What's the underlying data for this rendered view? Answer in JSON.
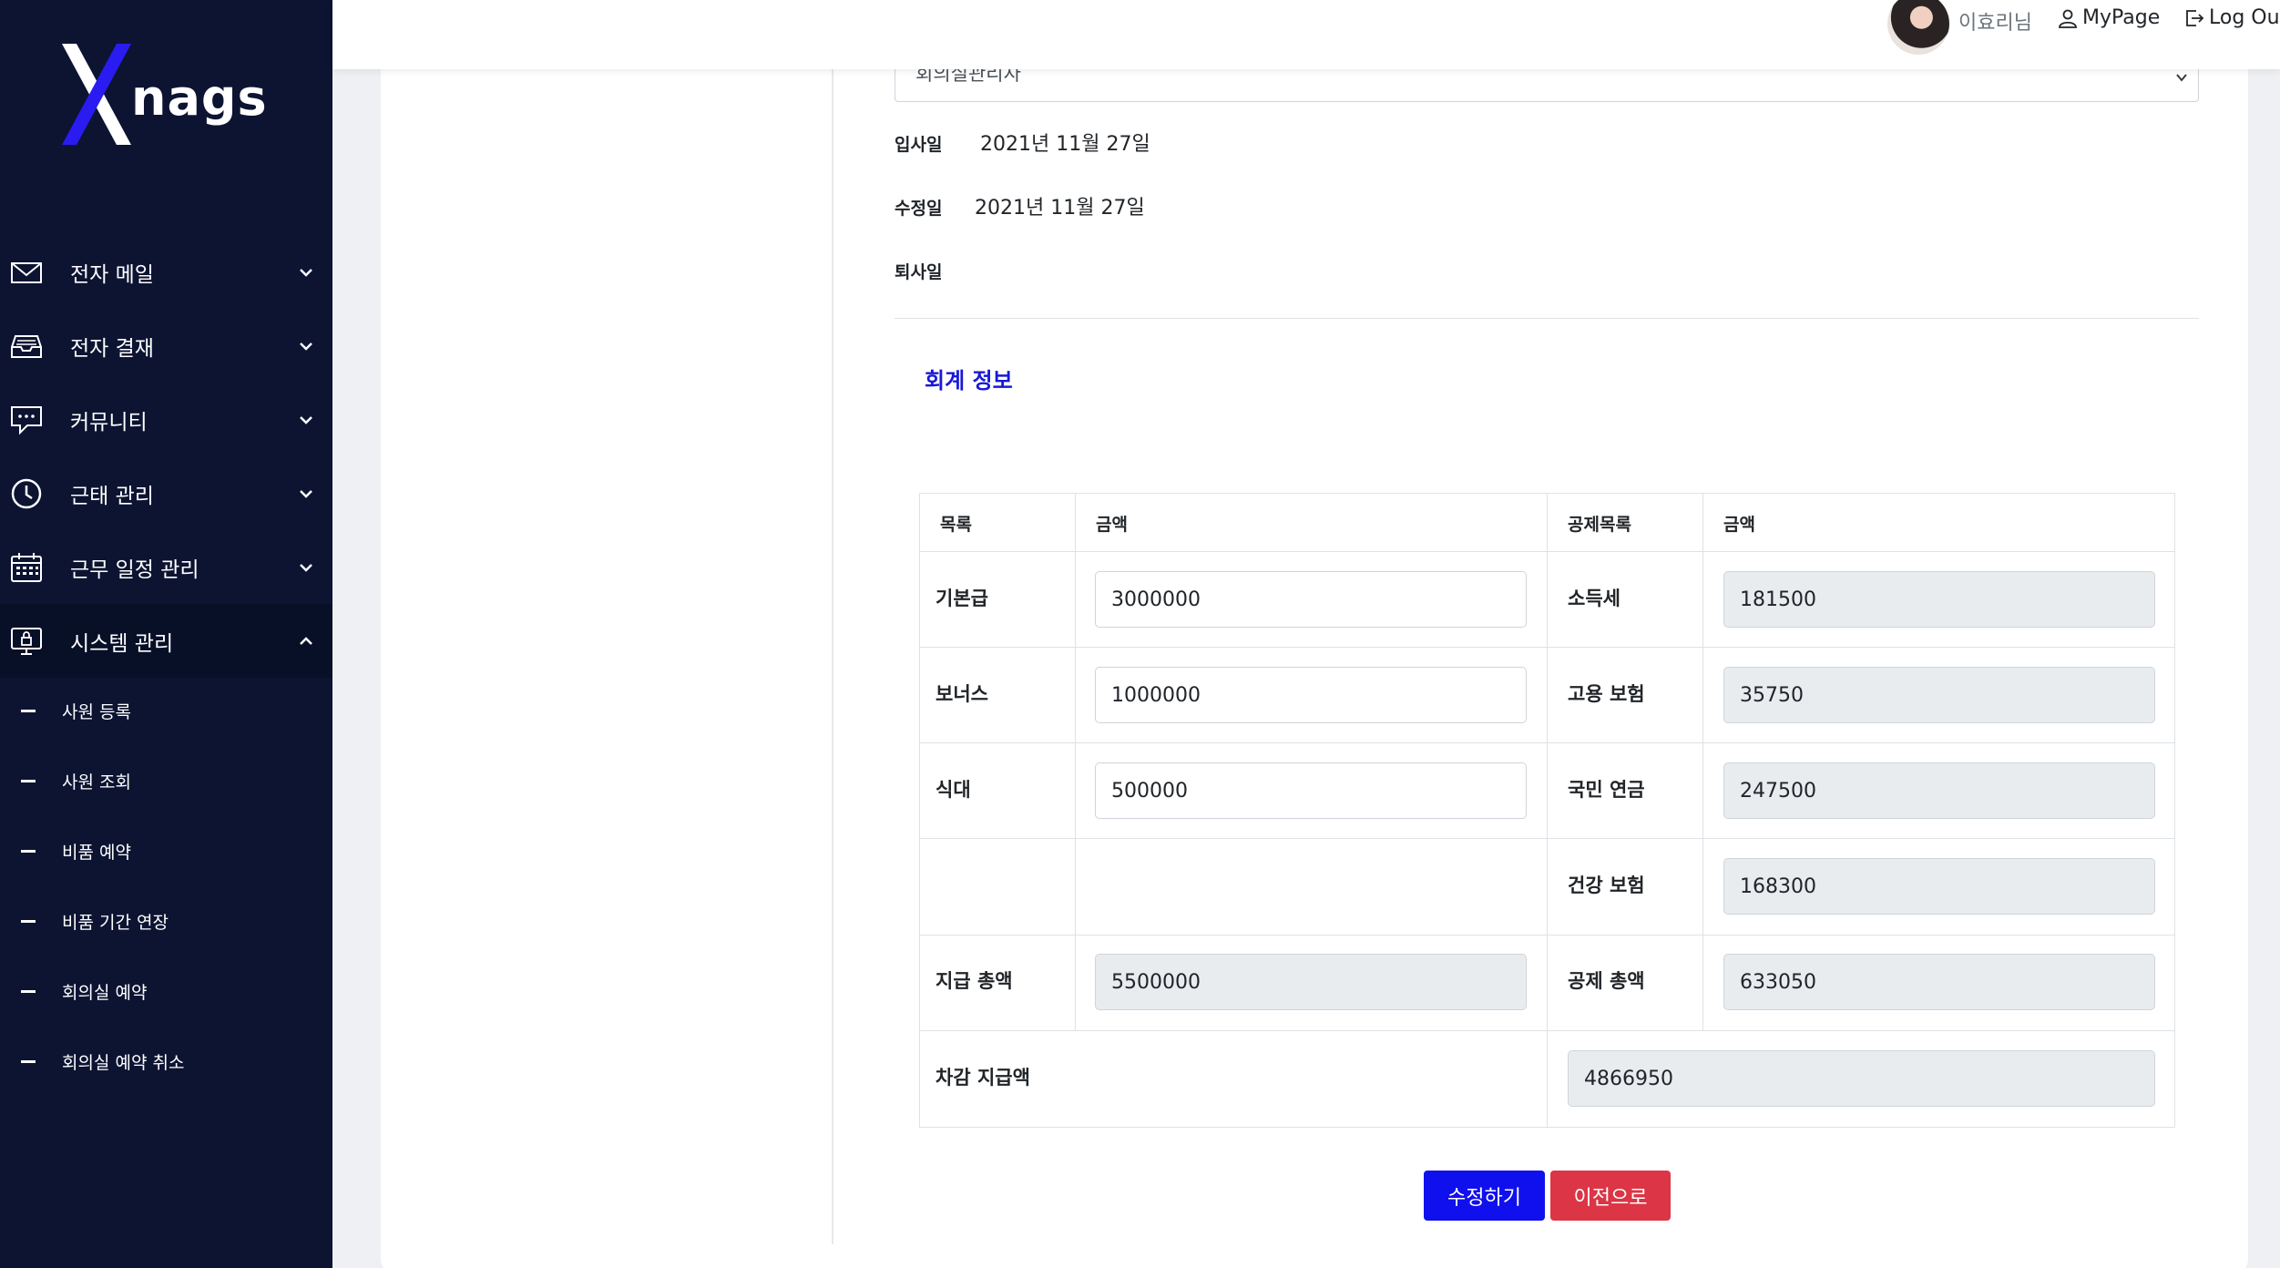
{
  "brand": {
    "logo_text": "nags",
    "logo_letter": "X"
  },
  "sidebar": {
    "items": [
      {
        "label": "전자 메일",
        "icon": "mail-icon"
      },
      {
        "label": "전자 결재",
        "icon": "inbox-icon"
      },
      {
        "label": "커뮤니티",
        "icon": "chat-icon"
      },
      {
        "label": "근태 관리",
        "icon": "clock-icon"
      },
      {
        "label": "근무 일정 관리",
        "icon": "calendar-icon"
      },
      {
        "label": "시스템 관리",
        "icon": "monitor-lock-icon"
      }
    ],
    "subitems": [
      {
        "label": "사원 등록"
      },
      {
        "label": "사원 조회"
      },
      {
        "label": "비품 예약"
      },
      {
        "label": "비품 기간 연장"
      },
      {
        "label": "회의실 예약"
      },
      {
        "label": "회의실 예약 취소"
      }
    ]
  },
  "topbar": {
    "user": "이효리님",
    "mypage": "MyPage",
    "logout": "Log Out"
  },
  "form": {
    "role_select": "회의실관리자",
    "hire_label": "입사일",
    "hire_value": "2021년 11월 27일",
    "modified_label": "수정일",
    "modified_value": "2021년 11월 27일",
    "retire_label": "퇴사일",
    "retire_value": ""
  },
  "accounting": {
    "title": "회계 정보",
    "headers": {
      "item": "목록",
      "amount": "금액",
      "deduction_item": "공제목록",
      "deduction_amount": "금액"
    },
    "rows": [
      {
        "label": "기본급",
        "value": "3000000",
        "d_label": "소득세",
        "d_value": "181500"
      },
      {
        "label": "보너스",
        "value": "1000000",
        "d_label": "고용 보험",
        "d_value": "35750"
      },
      {
        "label": "식대",
        "value": "500000",
        "d_label": "국민 연금",
        "d_value": "247500"
      },
      {
        "label": "",
        "value": "",
        "d_label": "건강 보험",
        "d_value": "168300"
      },
      {
        "label": "지급 총액",
        "value": "5500000",
        "d_label": "공제 총액",
        "d_value": "633050"
      }
    ],
    "net_label": "차감 지급액",
    "net_value": "4866950"
  },
  "buttons": {
    "edit": "수정하기",
    "back": "이전으로"
  },
  "colors": {
    "sidebar_bg": "#0c1432",
    "primary": "#1010ee",
    "danger": "#dc3545",
    "title": "#1818d8"
  }
}
